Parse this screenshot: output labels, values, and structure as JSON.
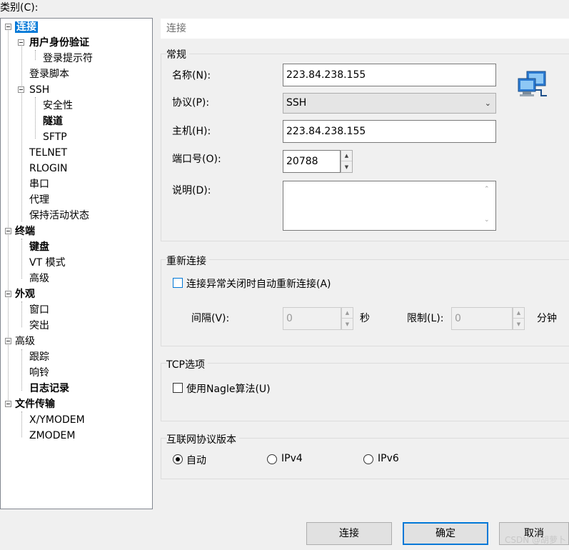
{
  "category_label": "类别(C):",
  "tree": {
    "items": [
      {
        "label": "连接",
        "level": 0,
        "bold": true,
        "selected": true,
        "expanded": true
      },
      {
        "label": "用户身份验证",
        "level": 1,
        "bold": true,
        "expanded": true
      },
      {
        "label": "登录提示符",
        "level": 2
      },
      {
        "label": "登录脚本",
        "level": 1
      },
      {
        "label": "SSH",
        "level": 1,
        "expanded": true
      },
      {
        "label": "安全性",
        "level": 2
      },
      {
        "label": "隧道",
        "level": 2,
        "bold": true
      },
      {
        "label": "SFTP",
        "level": 2
      },
      {
        "label": "TELNET",
        "level": 1
      },
      {
        "label": "RLOGIN",
        "level": 1
      },
      {
        "label": "串口",
        "level": 1
      },
      {
        "label": "代理",
        "level": 1
      },
      {
        "label": "保持活动状态",
        "level": 1
      },
      {
        "label": "终端",
        "level": 0,
        "bold": true,
        "expanded": true
      },
      {
        "label": "键盘",
        "level": 1,
        "bold": true
      },
      {
        "label": "VT 模式",
        "level": 1
      },
      {
        "label": "高级",
        "level": 1
      },
      {
        "label": "外观",
        "level": 0,
        "bold": true,
        "expanded": true
      },
      {
        "label": "窗口",
        "level": 1
      },
      {
        "label": "突出",
        "level": 1
      },
      {
        "label": "高级",
        "level": 0,
        "expanded": true
      },
      {
        "label": "跟踪",
        "level": 1
      },
      {
        "label": "响铃",
        "level": 1
      },
      {
        "label": "日志记录",
        "level": 1,
        "bold": true
      },
      {
        "label": "文件传输",
        "level": 0,
        "bold": true,
        "expanded": true
      },
      {
        "label": "X/YMODEM",
        "level": 1
      },
      {
        "label": "ZMODEM",
        "level": 1
      }
    ]
  },
  "panel": {
    "header": "连接",
    "general": {
      "title": "常规",
      "name_label": "名称(N):",
      "name_value": "223.84.238.155",
      "protocol_label": "协议(P):",
      "protocol_value": "SSH",
      "host_label": "主机(H):",
      "host_value": "223.84.238.155",
      "port_label": "端口号(O):",
      "port_value": "20788",
      "desc_label": "说明(D):",
      "desc_value": ""
    },
    "reconnect": {
      "title": "重新连接",
      "checkbox_label": "连接异常关闭时自动重新连接(A)",
      "checked": false,
      "interval_label": "间隔(V):",
      "interval_value": "0",
      "interval_unit": "秒",
      "limit_label": "限制(L):",
      "limit_value": "0",
      "limit_unit": "分钟"
    },
    "tcp": {
      "title": "TCP选项",
      "nagle_label": "使用Nagle算法(U)",
      "checked": false
    },
    "ip": {
      "title": "互联网协议版本",
      "options": [
        "自动",
        "IPv4",
        "IPv6"
      ],
      "selected": "自动"
    }
  },
  "buttons": {
    "connect": "连接",
    "ok": "确定",
    "cancel": "取消"
  },
  "watermark": "CSDN @胡萝卜",
  "colors": {
    "selection": "#0078d7",
    "panel_bg": "#f0f0f0"
  }
}
